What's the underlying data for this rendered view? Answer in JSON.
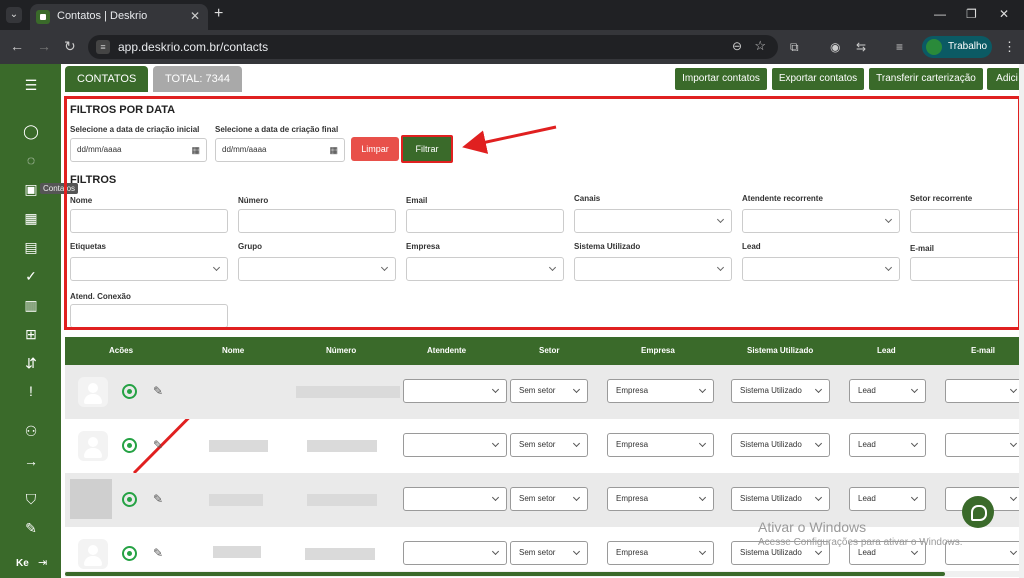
{
  "browser": {
    "tab_title": "Contatos | Deskrio",
    "url": "app.deskrio.com.br/contacts",
    "profile_label": "Trabalho"
  },
  "sidebar": {
    "icons": [
      "menu-icon",
      "user-icon",
      "chat-icon",
      "contact-card-icon",
      "grid-icon",
      "kanban-icon",
      "check-circle-icon",
      "calendar-icon",
      "add-message-icon",
      "route-icon",
      "alert-message-icon",
      "users-icon",
      "arrow-right-icon",
      "shield-icon",
      "edit-icon"
    ],
    "tooltip": "Contatos",
    "user_initials": "Ke"
  },
  "topbar": {
    "tab_contacts": "CONTATOS",
    "total_label": "TOTAL: 7344",
    "import_button": "Importar contatos",
    "export_button": "Exportar contatos",
    "transfer_button": "Transferir carterização",
    "add_button": "Adici"
  },
  "date_filters": {
    "title": "FILTROS POR DATA",
    "initial_label": "Selecione a data de criação inicial",
    "final_label": "Selecione a data de criação final",
    "initial_value": "dd/mm/aaaa",
    "final_value": "dd/mm/aaaa",
    "clear_button": "Limpar",
    "filter_button": "Filtrar"
  },
  "filters": {
    "title": "FILTROS",
    "row1": [
      "Nome",
      "Número",
      "Email",
      "Canais",
      "Atendente recorrente",
      "Setor recorrente"
    ],
    "row2": [
      "Etiquetas",
      "Grupo",
      "Empresa",
      "Sistema Utilizado",
      "Lead",
      "E-mail"
    ],
    "row3": [
      "Atend. Conexão"
    ]
  },
  "table": {
    "headers": [
      "Acões",
      "Nome",
      "Número",
      "Atendente",
      "Setor",
      "Empresa",
      "Sistema Utilizado",
      "Lead",
      "E-mail"
    ],
    "row_values": {
      "setor": "Sem setor",
      "empresa": "Empresa",
      "sistema": "Sistema Utilizado",
      "lead": "Lead"
    }
  },
  "watermark": {
    "line1": "Ativar o Windows",
    "line2": "Acesse Configurações para ativar o Windows."
  },
  "colors": {
    "brand_green": "#3a6a2a",
    "highlight_red": "#e02020",
    "clear_red": "#e8504a"
  }
}
